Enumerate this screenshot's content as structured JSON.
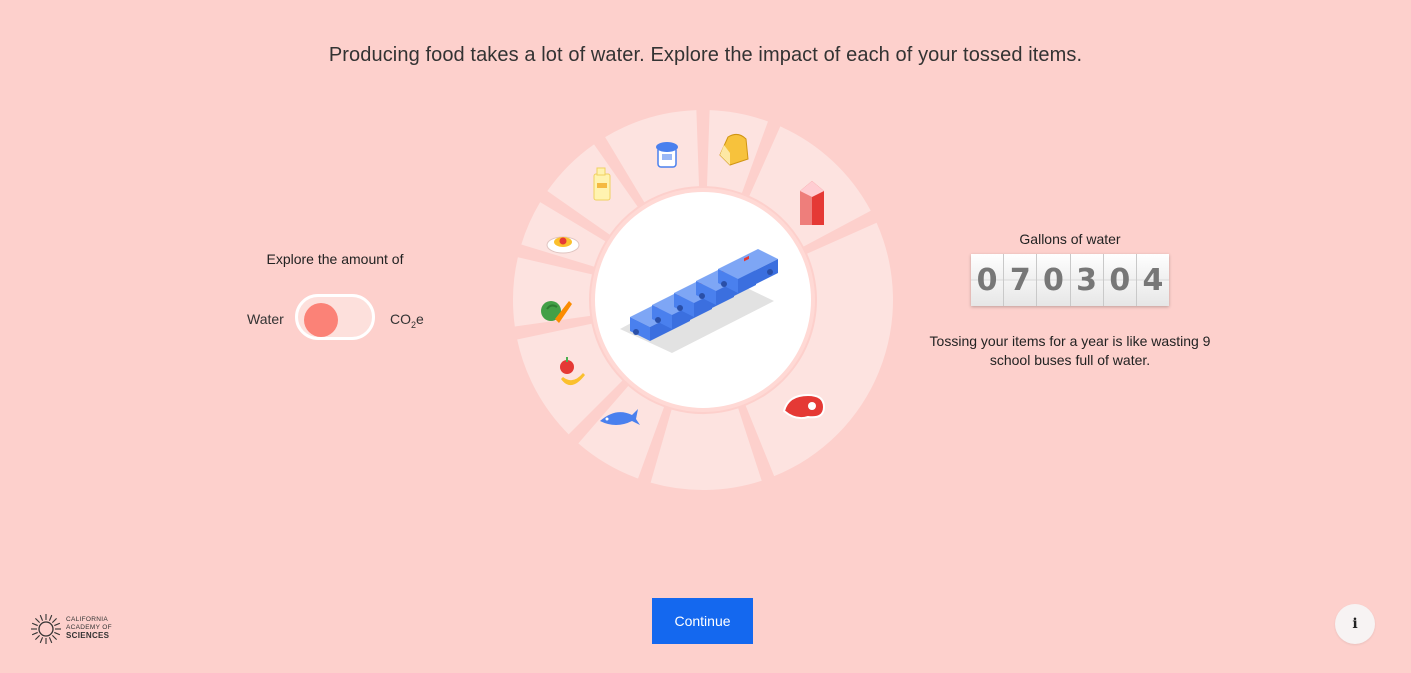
{
  "headline": "Producing food takes a lot of water. Explore the impact of each of your tossed items.",
  "toggle": {
    "label": "Explore the amount of",
    "left_option": "Water",
    "right_option_base": "CO",
    "right_option_sub": "2",
    "right_option_suffix": "e",
    "selected": "Water"
  },
  "wheel": {
    "segment_icons": [
      "yogurt-icon",
      "bread-icon",
      "milk-carton-icon",
      "steak-icon",
      "fish-icon",
      "fruit-icon",
      "vegetables-icon",
      "pasta-icon",
      "juice-icon"
    ]
  },
  "stats": {
    "label": "Gallons of water",
    "counter_digits": [
      "0",
      "7",
      "0",
      "3",
      "0",
      "4"
    ],
    "fact": "Tossing your items for a year is like wasting 9 school buses full of water."
  },
  "continue_label": "Continue",
  "logo": {
    "line1": "CALIFORNIA",
    "line2": "ACADEMY OF",
    "line3": "SCIENCES"
  },
  "info_label": "i",
  "colors": {
    "background": "#fdd0cc",
    "segment": "#fde3e0",
    "accent_knob": "#fb8277",
    "button": "#1468ef",
    "bus": "#4a80ee"
  }
}
